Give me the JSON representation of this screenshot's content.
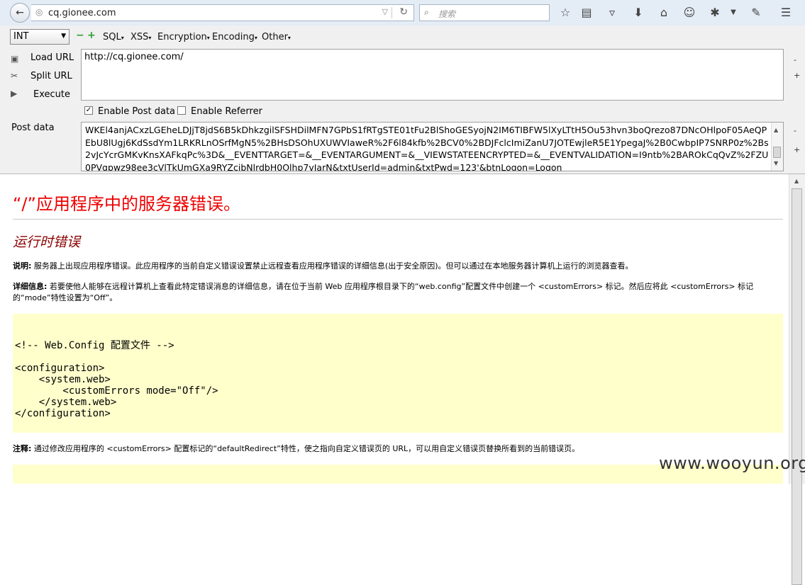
{
  "browser": {
    "url": "cq.gionee.com",
    "search_placeholder": "搜索"
  },
  "hackbar": {
    "type_select": "INT",
    "menus": [
      "SQL",
      "XSS",
      "Encryption",
      "Encoding",
      "Other"
    ],
    "load_url": "Load URL",
    "split_url": "Split URL",
    "execute": "Execute",
    "url_value": "http://cq.gionee.com/",
    "enable_post": "Enable Post data",
    "enable_referrer": "Enable Referrer",
    "post_label": "Post data",
    "post_value": "WKEl4anjACxzLGEheLDJjT8jdS6B5kDhkzgilSFSHDilMFN7GPbS1fRTgSTE01tFu2BlShoGESyojN2IM6TIBFW5lXyLTtH5Ou53hvn3boQrezo87DNcOHlpoF05AeQPEbU8lUgj6KdSsdYm1LRKRLnOSrfMgN5%2BHsDSOhUXUWVIaweR%2F6l84kfb%2BCV0%2BDJFclcImiZanU7JOTEwjleR5E1YpegaJ%2B0CwbpIP7SNRP0z%2Bs2vJcYcrGMKvKnsXAFkqPc%3D&__EVENTTARGET=&__EVENTARGUMENT=&__VIEWSTATEENCRYPTED=&__EVENTVALIDATION=I9ntb%2BAROkCqQvZ%2FZU0PVqpwz98ee3cVlTkUmGXa9RYZcibNlrdbH0Olhp7vIarN&txtUserId=admin&txtPwd=123'&btnLogon=Logon"
  },
  "page": {
    "title": "“/”应用程序中的服务器错误。",
    "subtitle": "运行时错误",
    "desc_label": "说明:",
    "desc_text": " 服务器上出现应用程序错误。此应用程序的当前自定义错误设置禁止远程查看应用程序错误的详细信息(出于安全原因)。但可以通过在本地服务器计算机上运行的浏览器查看。",
    "details_label": "详细信息:",
    "details_text": " 若要使他人能够在远程计算机上查看此特定错误消息的详细信息，请在位于当前 Web 应用程序根目录下的“web.config”配置文件中创建一个 <customErrors> 标记。然后应将此 <customErrors> 标记的“mode”特性设置为“Off”。",
    "code": "<!-- Web.Config 配置文件 -->\n\n<configuration>\n    <system.web>\n        <customErrors mode=\"Off\"/>\n    </system.web>\n</configuration>",
    "note_label": "注释:",
    "note_text": " 通过修改应用程序的 <customErrors> 配置标记的“defaultRedirect”特性，使之指向自定义错误页的 URL，可以用自定义错误页替换所看到的当前错误页。"
  },
  "watermark": "www.wooyun.org"
}
